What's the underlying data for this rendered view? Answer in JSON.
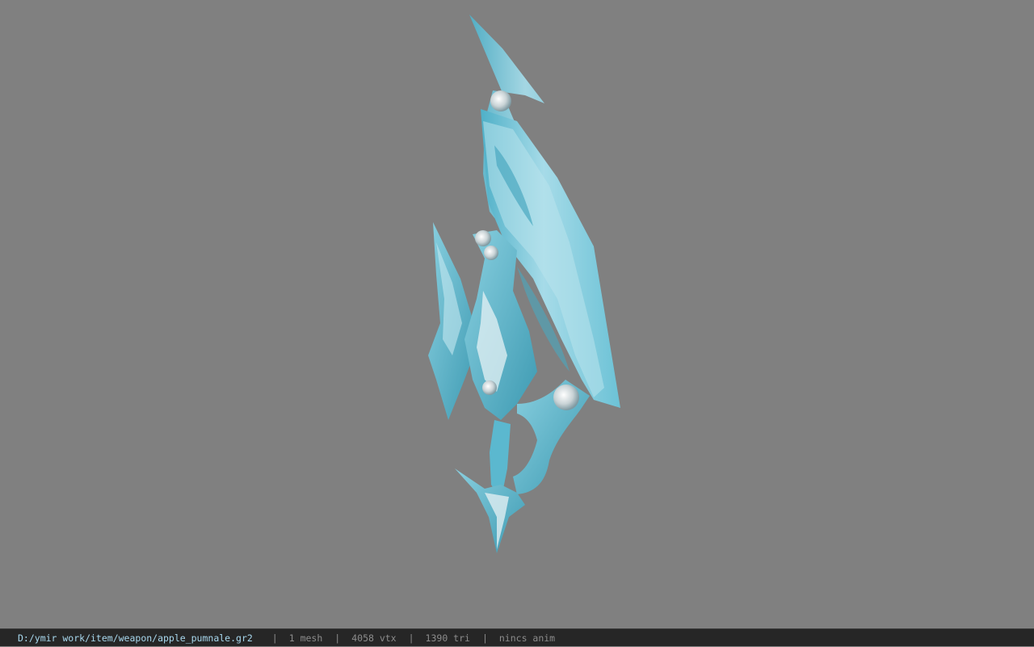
{
  "viewer": {
    "background_color": "#808080",
    "model_icon": "crystal-dagger-model",
    "model_colors": {
      "blade": "#7cc9da",
      "blade_light": "#bfe6ee",
      "blade_dark": "#3f9bb3",
      "gem": "#e4e8ea"
    }
  },
  "statusbar": {
    "file_path": "D:/ymir work/item/weapon/apple_pumnale.gr2",
    "separator": "|",
    "mesh_count": "1 mesh",
    "vertex_count": "4058 vtx",
    "triangle_count": "1390 tri",
    "animation_status": "nincs anim",
    "path_color": "#a8d8ee",
    "text_color": "#8c8c8c"
  }
}
